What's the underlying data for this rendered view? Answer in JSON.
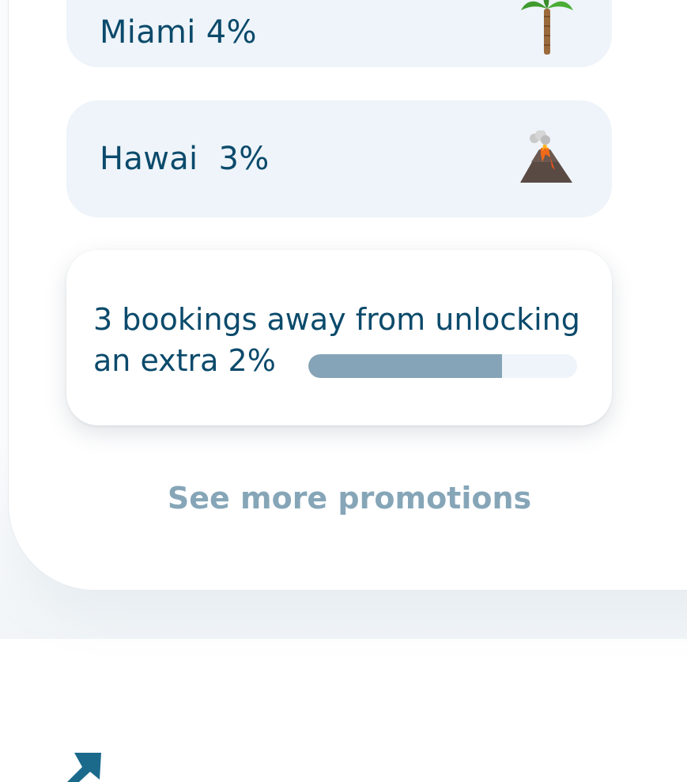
{
  "promotions": [
    {
      "label": "Miami 4%",
      "icon": "palm-tree-icon"
    },
    {
      "label": "Hawai  3%",
      "icon": "volcano-icon"
    }
  ],
  "progress": {
    "text": "3 bookings away from unlocking an extra 2%",
    "fill_fraction": 0.72
  },
  "see_more_label": "See more promotions",
  "colors": {
    "primary_text": "#0b4a6b",
    "muted_text": "#86a6b8",
    "card_bg": "#eef4f9",
    "progress_fill": "#85a4b7",
    "arrow": "#1b6a8c"
  }
}
